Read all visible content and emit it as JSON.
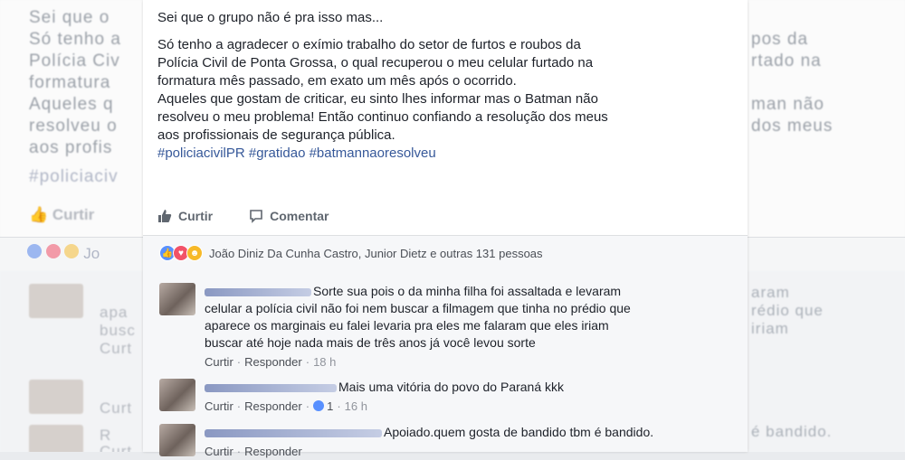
{
  "post": {
    "first_line": "Sei que o grupo não é pra isso mas...",
    "lines": [
      "Só tenho a agradecer o exímio trabalho do setor de furtos e roubos da",
      "Polícia Civil de Ponta Grossa, o qual recuperou o meu celular furtado na",
      "formatura mês passado, em exato um mês após o ocorrido.",
      "Aqueles que gostam de criticar, eu sinto lhes informar mas o Batman não",
      "resolveu o meu problema! Então continuo confiando a resolução dos meus",
      "aos profissionais de segurança pública."
    ],
    "hashtags": "#policiacivilPR #gratidao #batmannaoresolveu"
  },
  "actions": {
    "like": "Curtir",
    "comment": "Comentar"
  },
  "reactions": {
    "summary": "João Diniz Da Cunha Castro, Junior Dietz e outras 131 pessoas",
    "icons": [
      "like-icon",
      "love-icon",
      "haha-icon"
    ],
    "colors": {
      "like": "#5890ff",
      "love": "#f25268",
      "haha": "#f7b928"
    }
  },
  "comments": [
    {
      "text_lines": [
        "Sorte sua pois o da minha filha foi assaltada e levaram",
        "celular a polícia civil não foi nem buscar a filmagem que tinha no prédio que",
        "aparece os marginais eu falei levaria pra eles me falaram que eles iriam",
        "buscar até hoje nada mais de três anos já você levou sorte"
      ],
      "like_label": "Curtir",
      "reply_label": "Responder",
      "time": "18 h"
    },
    {
      "text_lines": [
        "Mais uma vitória do povo do Paraná kkk"
      ],
      "like_label": "Curtir",
      "reply_label": "Responder",
      "likes": "1",
      "time": "16 h"
    },
    {
      "text_lines": [
        "Apoiado.quem gosta de bandido tbm é bandido."
      ],
      "like_label": "Curtir",
      "reply_label": "Responder"
    }
  ],
  "background": {
    "lines": [
      "Sei que o",
      "Só tenho a",
      "Polícia Civ",
      "formatura",
      "Aqueles q",
      "resolveu o",
      "aos profis"
    ],
    "right_lines": [
      "pos da",
      "rtado na",
      "",
      "man não",
      "dos meus"
    ],
    "hashtag": "#policiaciv",
    "curtir": "Curtir",
    "reactions_text": "Jo",
    "comment_right": [
      "aram",
      "rédio que",
      "iriam",
      "",
      "",
      "é bandido."
    ],
    "comment_left": [
      "apa",
      "busc",
      "Curt",
      "Curt",
      "R",
      "Curt"
    ]
  }
}
